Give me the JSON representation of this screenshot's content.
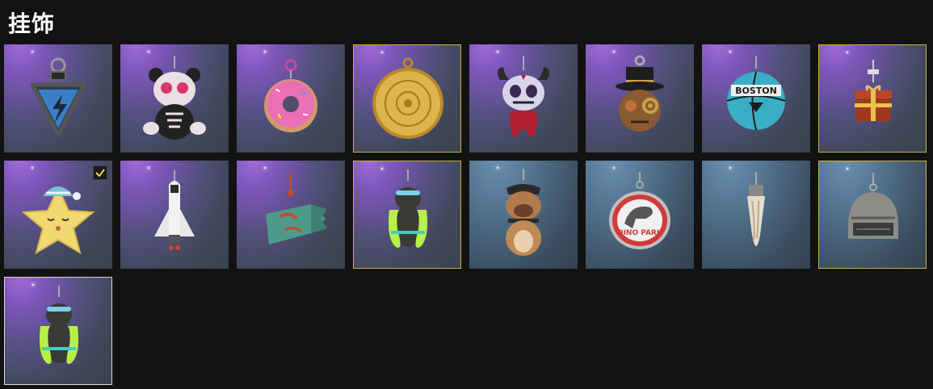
{
  "header": {
    "title": "挂饰"
  },
  "items": [
    {
      "icon": "lightning-triangle-charm-icon",
      "equipped": false
    },
    {
      "icon": "sugar-skull-panda-charm-icon",
      "equipped": false
    },
    {
      "icon": "donut-charm-icon",
      "equipped": false
    },
    {
      "icon": "gold-medallion-charm-icon",
      "equipped": false
    },
    {
      "icon": "horned-skull-doll-charm-icon",
      "equipped": false
    },
    {
      "icon": "top-hat-steampunk-charm-icon",
      "equipped": false
    },
    {
      "icon": "basketball-charm-icon",
      "equipped": false,
      "label": "BOSTON"
    },
    {
      "icon": "gift-box-charm-icon",
      "equipped": false
    },
    {
      "icon": "sleepy-star-charm-icon",
      "equipped": true
    },
    {
      "icon": "space-shuttle-charm-icon",
      "equipped": false
    },
    {
      "icon": "koi-fish-charm-icon",
      "equipped": false
    },
    {
      "icon": "seal-with-float-charm-icon",
      "equipped": false
    },
    {
      "icon": "bulldog-charm-icon",
      "equipped": false
    },
    {
      "icon": "dino-park-badge-charm-icon",
      "equipped": false,
      "label": "DINO PARK"
    },
    {
      "icon": "fang-tooth-charm-icon",
      "equipped": false
    },
    {
      "icon": "level3-helmet-charm-icon",
      "equipped": false
    },
    {
      "icon": "seal-with-float-charm-icon",
      "equipped": false,
      "selected": true
    }
  ],
  "colors": {
    "background": "#121212",
    "gold_border": "#c9b04a",
    "selected_border": "#d9d9d9",
    "equipped_check": "#e8d35a"
  }
}
